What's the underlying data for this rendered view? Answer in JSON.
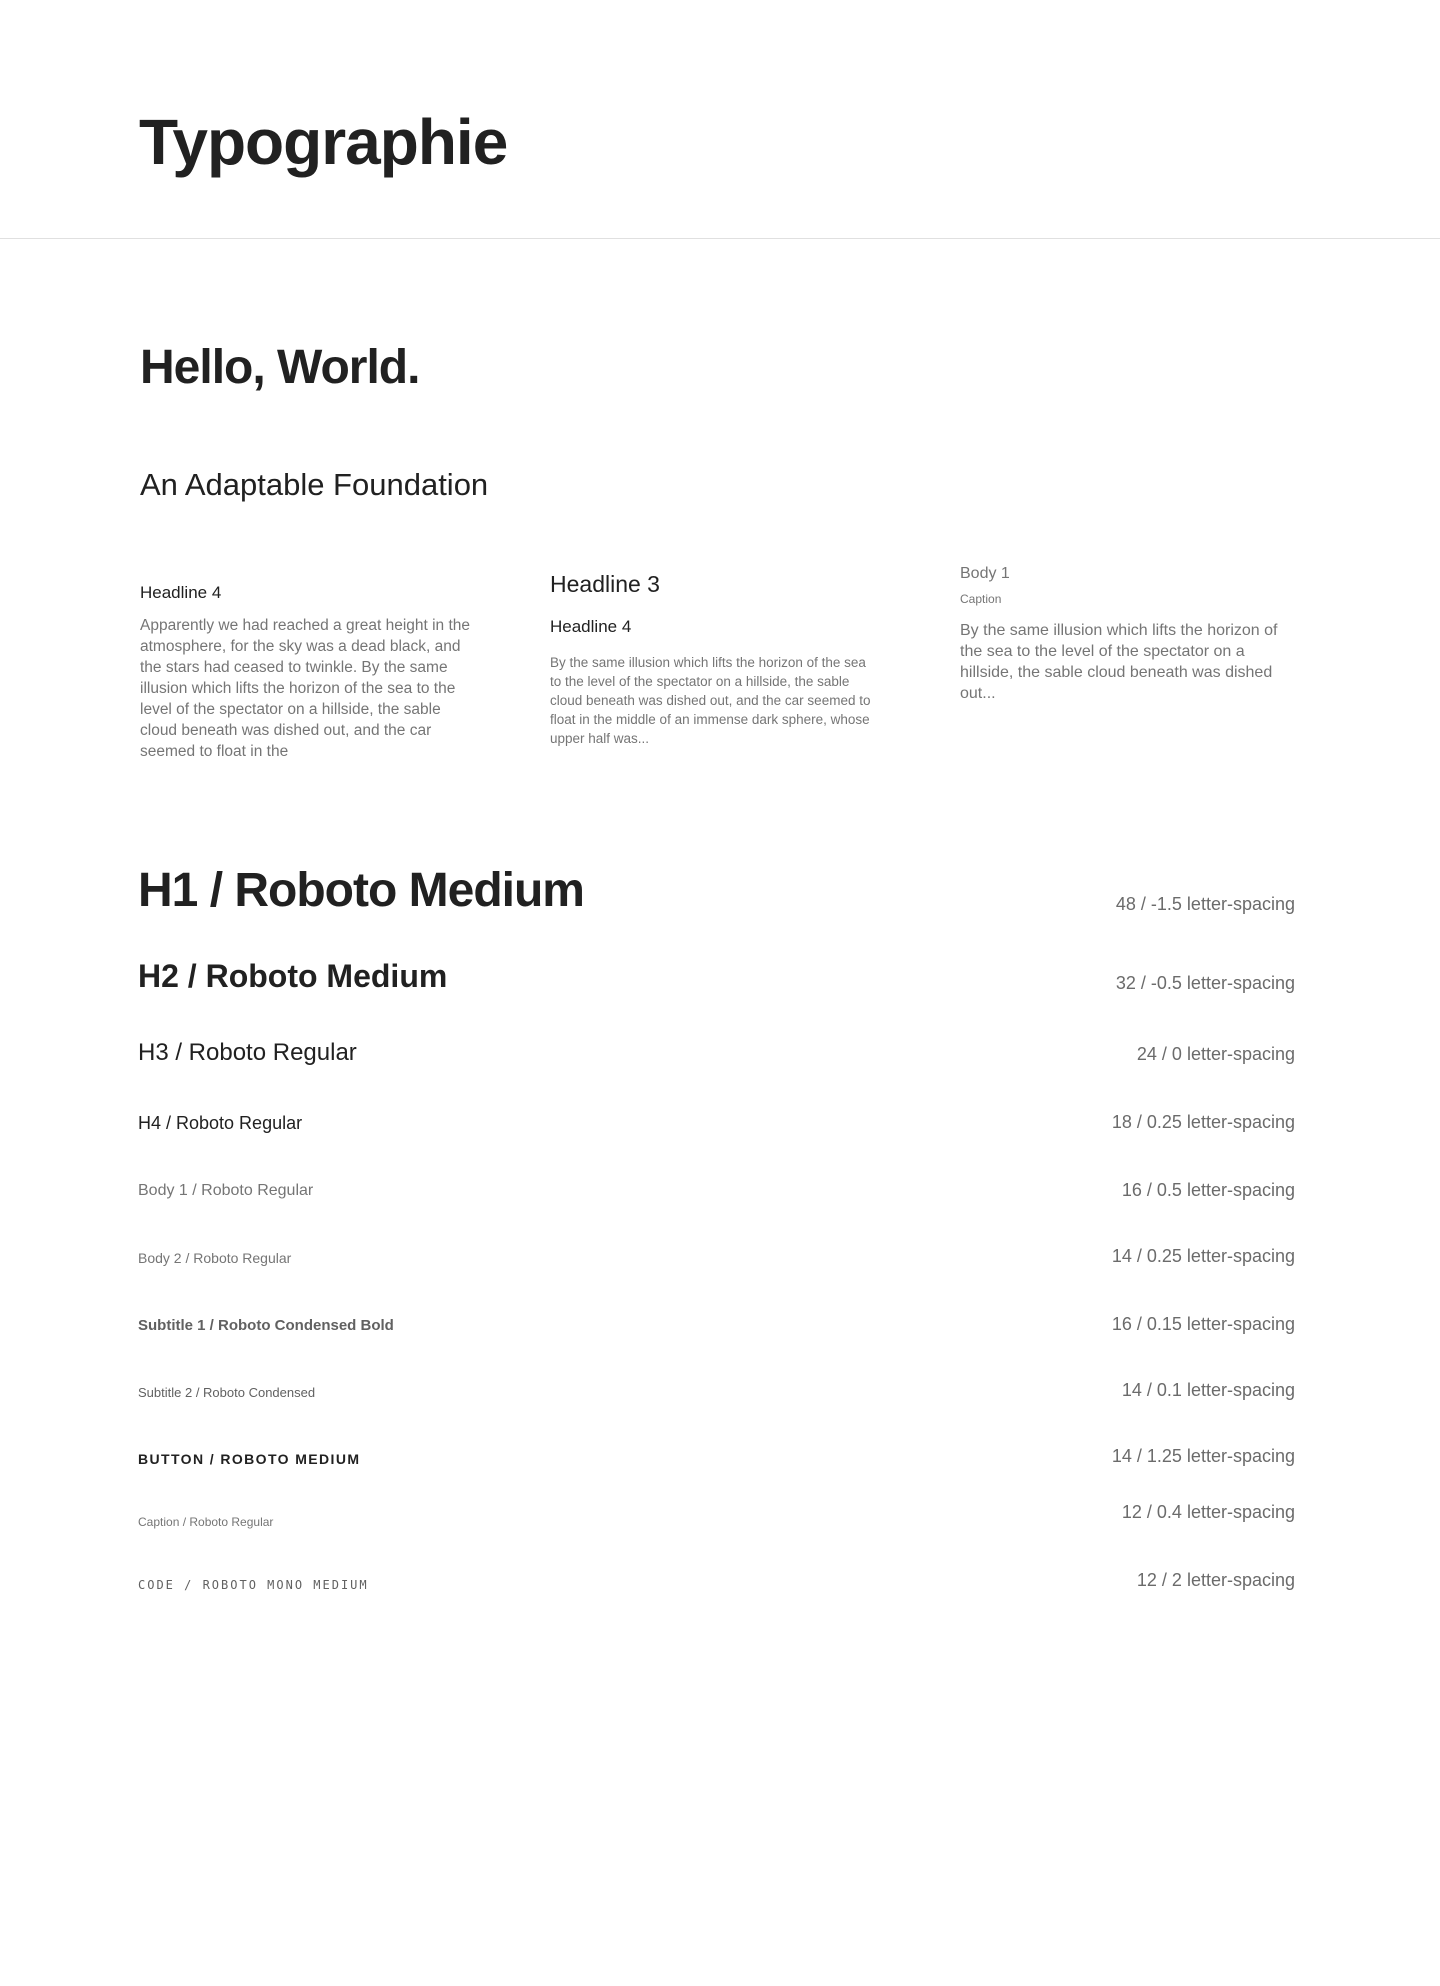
{
  "page": {
    "title": "Typographie"
  },
  "showcase": {
    "hello": "Hello, World.",
    "foundation": "An Adaptable Foundation",
    "column1": {
      "heading": "Headline 4",
      "text": "Apparently we had reached a great height in the atmosphere, for the sky was a dead black, and the stars had ceased to twinkle. By the same illusion which lifts the horizon of the sea to the level of the spectator on a hillside, the sable cloud beneath was dished out, and the car seemed to float in the"
    },
    "column2": {
      "heading3": "Headline 3",
      "heading4": "Headline 4",
      "text": "By the same illusion which lifts the horizon of the sea to the level of the spectator on a hillside, the sable cloud beneath was dished out, and the car seemed to float in the middle of an immense dark sphere, whose upper half was..."
    },
    "column3": {
      "body1": "Body 1",
      "caption": "Caption",
      "text": "By the same illusion which lifts the horizon of the sea to the level of the spectator on a hillside, the sable cloud beneath was dished out..."
    }
  },
  "type_scale": [
    {
      "name": "H1 / Roboto Medium",
      "spec": "48 / -1.5 letter-spacing"
    },
    {
      "name": "H2 / Roboto Medium",
      "spec": "32 / -0.5 letter-spacing"
    },
    {
      "name": "H3 / Roboto Regular",
      "spec": "24 / 0 letter-spacing"
    },
    {
      "name": "H4 / Roboto Regular",
      "spec": "18 / 0.25 letter-spacing"
    },
    {
      "name": "Body 1 / Roboto Regular",
      "spec": "16 / 0.5 letter-spacing"
    },
    {
      "name": "Body 2 / Roboto Regular",
      "spec": "14 / 0.25 letter-spacing"
    },
    {
      "name": "Subtitle 1 / Roboto Condensed Bold",
      "spec": "16 / 0.15 letter-spacing"
    },
    {
      "name": "Subtitle 2 / Roboto Condensed",
      "spec": "14 / 0.1 letter-spacing"
    },
    {
      "name": "BUTTON / ROBOTO MEDIUM",
      "spec": "14 / 1.25 letter-spacing"
    },
    {
      "name": "Caption / Roboto Regular",
      "spec": "12 / 0.4 letter-spacing"
    },
    {
      "name": "CODE / ROBOTO MONO MEDIUM",
      "spec": "12 / 2 letter-spacing"
    }
  ],
  "colors": {
    "text_primary": "#212121",
    "text_secondary": "#757575",
    "divider": "#e0e0e0",
    "background": "#ffffff"
  }
}
